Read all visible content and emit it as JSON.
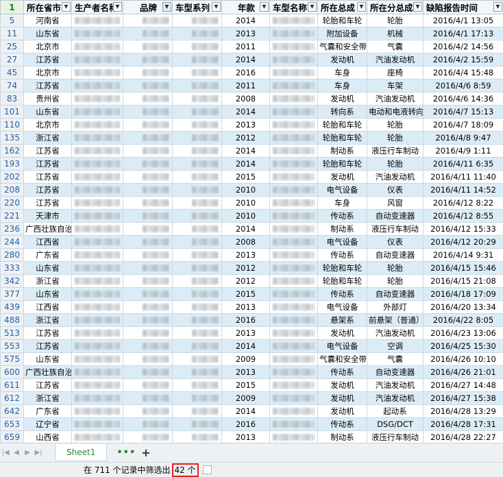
{
  "grid": {
    "corner_label": "1",
    "headers": [
      "所在省市",
      "生产者名称",
      "品牌",
      "车型系列",
      "年款",
      "车型名称",
      "所在总成",
      "所在分总成",
      "缺陷报告时间"
    ],
    "rows": [
      {
        "n": "5",
        "prov": "河南省",
        "year": "2014",
        "asm": "轮胎和车轮",
        "sub": "轮胎",
        "time": "2016/4/1 13:05"
      },
      {
        "n": "11",
        "prov": "山东省",
        "year": "2013",
        "asm": "附加设备",
        "sub": "机械",
        "time": "2016/4/1 17:13"
      },
      {
        "n": "25",
        "prov": "北京市",
        "year": "2011",
        "asm": "气囊和安全带",
        "sub": "气囊",
        "time": "2016/4/2 14:56"
      },
      {
        "n": "27",
        "prov": "江苏省",
        "year": "2014",
        "asm": "发动机",
        "sub": "汽油发动机",
        "time": "2016/4/2 15:59"
      },
      {
        "n": "45",
        "prov": "北京市",
        "year": "2016",
        "asm": "车身",
        "sub": "座椅",
        "time": "2016/4/4 15:48"
      },
      {
        "n": "74",
        "prov": "江苏省",
        "year": "2011",
        "asm": "车身",
        "sub": "车架",
        "time": "2016/4/6 8:59"
      },
      {
        "n": "83",
        "prov": "贵州省",
        "year": "2008",
        "asm": "发动机",
        "sub": "汽油发动机",
        "time": "2016/4/6 14:36"
      },
      {
        "n": "101",
        "prov": "山东省",
        "year": "2014",
        "asm": "转向系",
        "sub": "电动和电液转向助力",
        "time": "2016/4/7 15:13"
      },
      {
        "n": "110",
        "prov": "北京市",
        "year": "2013",
        "asm": "轮胎和车轮",
        "sub": "轮胎",
        "time": "2016/4/7 18:09"
      },
      {
        "n": "135",
        "prov": "浙江省",
        "year": "2012",
        "asm": "轮胎和车轮",
        "sub": "轮胎",
        "time": "2016/4/8 9:47"
      },
      {
        "n": "162",
        "prov": "江苏省",
        "year": "2014",
        "asm": "制动系",
        "sub": "液压行车制动",
        "time": "2016/4/9 1:11"
      },
      {
        "n": "193",
        "prov": "江苏省",
        "year": "2014",
        "asm": "轮胎和车轮",
        "sub": "轮胎",
        "time": "2016/4/11 6:35"
      },
      {
        "n": "202",
        "prov": "江苏省",
        "year": "2015",
        "asm": "发动机",
        "sub": "汽油发动机",
        "time": "2016/4/11 11:40"
      },
      {
        "n": "208",
        "prov": "江苏省",
        "year": "2010",
        "asm": "电气设备",
        "sub": "仪表",
        "time": "2016/4/11 14:52"
      },
      {
        "n": "220",
        "prov": "江苏省",
        "year": "2010",
        "asm": "车身",
        "sub": "风窗",
        "time": "2016/4/12 8:22"
      },
      {
        "n": "221",
        "prov": "天津市",
        "year": "2010",
        "asm": "传动系",
        "sub": "自动变速器",
        "time": "2016/4/12 8:55"
      },
      {
        "n": "236",
        "prov": "广西壮族自治区",
        "year": "2014",
        "asm": "制动系",
        "sub": "液压行车制动",
        "time": "2016/4/12 15:33"
      },
      {
        "n": "244",
        "prov": "江西省",
        "year": "2008",
        "asm": "电气设备",
        "sub": "仪表",
        "time": "2016/4/12 20:29"
      },
      {
        "n": "280",
        "prov": "广东省",
        "year": "2013",
        "asm": "传动系",
        "sub": "自动变速器",
        "time": "2016/4/14 9:31"
      },
      {
        "n": "333",
        "prov": "山东省",
        "year": "2012",
        "asm": "轮胎和车轮",
        "sub": "轮胎",
        "time": "2016/4/15 15:46"
      },
      {
        "n": "342",
        "prov": "浙江省",
        "year": "2012",
        "asm": "轮胎和车轮",
        "sub": "轮胎",
        "time": "2016/4/15 21:08"
      },
      {
        "n": "377",
        "prov": "山东省",
        "year": "2015",
        "asm": "传动系",
        "sub": "自动变速器",
        "time": "2016/4/18 17:09"
      },
      {
        "n": "439",
        "prov": "江西省",
        "year": "2013",
        "asm": "电气设备",
        "sub": "外部灯",
        "time": "2016/4/20 13:34"
      },
      {
        "n": "488",
        "prov": "浙江省",
        "year": "2016",
        "asm": "悬架系",
        "sub": "前悬架（普通）",
        "time": "2016/4/22 8:05"
      },
      {
        "n": "513",
        "prov": "江苏省",
        "year": "2013",
        "asm": "发动机",
        "sub": "汽油发动机",
        "time": "2016/4/23 13:06"
      },
      {
        "n": "553",
        "prov": "江苏省",
        "year": "2014",
        "asm": "电气设备",
        "sub": "空调",
        "time": "2016/4/25 15:30"
      },
      {
        "n": "575",
        "prov": "山东省",
        "year": "2009",
        "asm": "气囊和安全带",
        "sub": "气囊",
        "time": "2016/4/26 10:10"
      },
      {
        "n": "600",
        "prov": "广西壮族自治区",
        "year": "2013",
        "asm": "传动系",
        "sub": "自动变速器",
        "time": "2016/4/26 21:01"
      },
      {
        "n": "611",
        "prov": "江苏省",
        "year": "2015",
        "asm": "发动机",
        "sub": "汽油发动机",
        "time": "2016/4/27 14:48"
      },
      {
        "n": "612",
        "prov": "浙江省",
        "year": "2009",
        "asm": "发动机",
        "sub": "汽油发动机",
        "time": "2016/4/27 15:38"
      },
      {
        "n": "642",
        "prov": "广东省",
        "year": "2014",
        "asm": "发动机",
        "sub": "起动系",
        "time": "2016/4/28 13:29"
      },
      {
        "n": "653",
        "prov": "辽宁省",
        "year": "2016",
        "asm": "传动系",
        "sub": "DSG/DCT",
        "time": "2016/4/28 17:31"
      },
      {
        "n": "659",
        "prov": "山西省",
        "year": "2013",
        "asm": "制动系",
        "sub": "液压行车制动",
        "time": "2016/4/28 22:27"
      }
    ]
  },
  "sheet_tabs": {
    "active": "Sheet1",
    "more_icon": "more-dots-icon",
    "add_icon": "plus-icon"
  },
  "status": {
    "text": "在 711 个记录中筛选出",
    "count": "42 个"
  }
}
